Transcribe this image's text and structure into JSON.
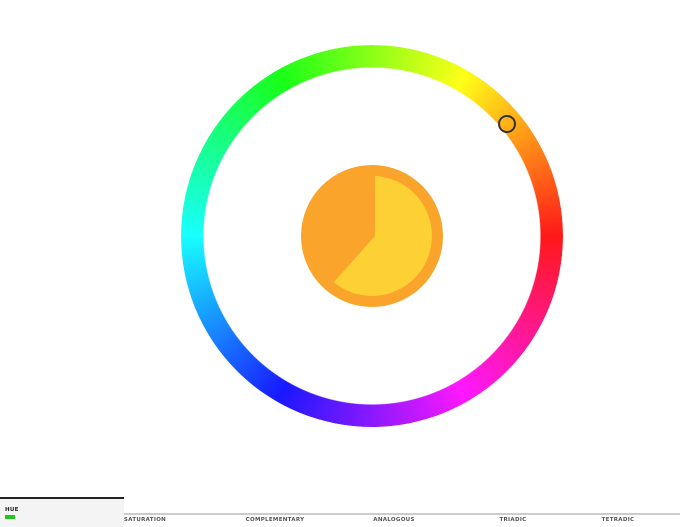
{
  "color_picker": {
    "hue_ring": {
      "gradient_stops": [
        "#ff0000",
        "#ff00ff",
        "#0000ff",
        "#00ffff",
        "#00ff00",
        "#ffff00"
      ]
    },
    "preview": {
      "primary_color": "#fdd134",
      "secondary_color": "#fba42b",
      "selected_fraction": 0.39
    }
  },
  "tabs": [
    {
      "label": "HUE",
      "swatch_color": "#1ec81e",
      "active": true
    },
    {
      "label": "SATURATION",
      "active": false
    },
    {
      "label": "COMPLEMENTARY",
      "active": false
    },
    {
      "label": "ANALOGOUS",
      "active": false
    },
    {
      "label": "TRIADIC",
      "active": false
    },
    {
      "label": "TETRADIC",
      "active": false
    }
  ]
}
